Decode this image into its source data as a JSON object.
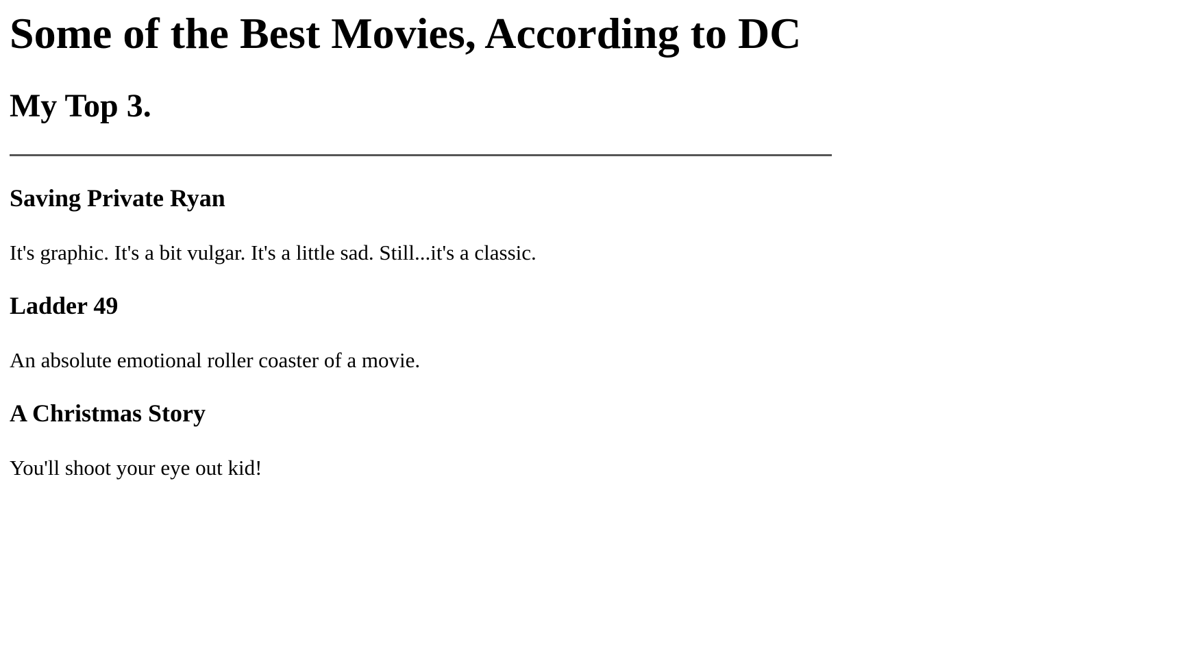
{
  "page": {
    "title": "Some of the Best Movies, According to DC",
    "subtitle": "My Top 3."
  },
  "movies": [
    {
      "title": "Saving Private Ryan",
      "description": "It's graphic. It's a bit vulgar. It's a little sad. Still...it's a classic."
    },
    {
      "title": "Ladder 49",
      "description": "An absolute emotional roller coaster of a movie."
    },
    {
      "title": "A Christmas Story",
      "description": "You'll shoot your eye out kid!"
    }
  ]
}
